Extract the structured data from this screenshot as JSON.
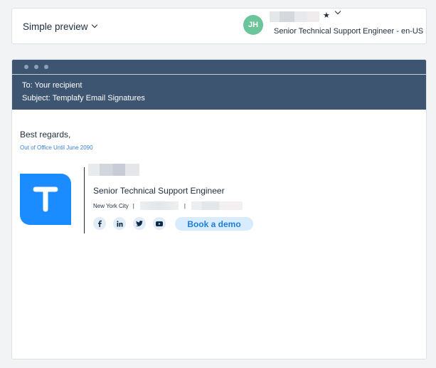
{
  "topbar": {
    "preview_label": "Simple preview",
    "avatar_initials": "JH",
    "user_role": "Senior Technical Support Engineer - en-US"
  },
  "email": {
    "to": "To: Your recipient",
    "subject": "Subject: Templafy Email Signatures",
    "greeting": "Best regards,",
    "out_of_office": "Out of Office Until June 2090"
  },
  "signature": {
    "logo_letter": "T",
    "title": "Senior Technical Support Engineer",
    "city": "New York City",
    "separator": "|",
    "socials": [
      "f",
      "in",
      "tw",
      "yt"
    ],
    "cta_label": "Book a demo"
  },
  "colors": {
    "header_bg": "#3d5570",
    "logo_bg": "#1a8cff",
    "avatar_bg": "#6bc49a",
    "cta_bg": "#d9ecfd",
    "cta_text": "#1a7fe0",
    "link": "#3b7fd8"
  }
}
